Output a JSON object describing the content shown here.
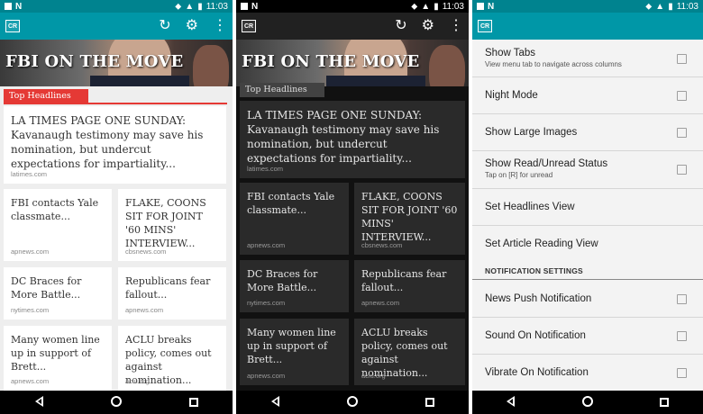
{
  "status": {
    "time": "11:03",
    "notif": "N"
  },
  "logo": "CR",
  "toolbar_icons": [
    "refresh-icon",
    "settings-icon",
    "overflow-menu-icon"
  ],
  "hero_title": "FBI ON THE MOVE",
  "section_label": "Top Headlines",
  "feed": {
    "top": {
      "headline": "LA TIMES PAGE ONE SUNDAY: Kavanaugh testimony may save his nomination, but undercut expectations for impartiality...",
      "source": "latimes.com"
    },
    "cards": [
      {
        "headline": "FBI contacts Yale classmate...",
        "source": "apnews.com"
      },
      {
        "headline": "FLAKE, COONS SIT FOR JOINT '60 MINS' INTERVIEW...",
        "source": "cbsnews.com"
      },
      {
        "headline": "DC Braces for More Battle...",
        "source": "nytimes.com"
      },
      {
        "headline": "Republicans fear fallout...",
        "source": "apnews.com"
      },
      {
        "headline": "Many women line up in support of Brett...",
        "source": "apnews.com"
      },
      {
        "headline": "ACLU breaks policy, comes out against nomination...",
        "source": "aclu.org"
      }
    ]
  },
  "settings": {
    "show_tabs": {
      "title": "Show Tabs",
      "sub": "View menu tab to navigate across columns"
    },
    "night_mode": "Night Mode",
    "show_large_images": "Show Large Images",
    "show_read_unread": {
      "title": "Show Read/Unread Status",
      "sub": "Tap on [R] for unread"
    },
    "set_headlines_view": "Set Headlines View",
    "set_article_view": "Set Article Reading View",
    "notification_header": "NOTIFICATION SETTINGS",
    "news_push": "News Push Notification",
    "sound": "Sound On Notification",
    "vibrate": "Vibrate On Notification"
  },
  "colors": {
    "teal": "#0097a7",
    "teal_dark": "#00838f",
    "red": "#e53935",
    "dark_bar": "#212121"
  }
}
